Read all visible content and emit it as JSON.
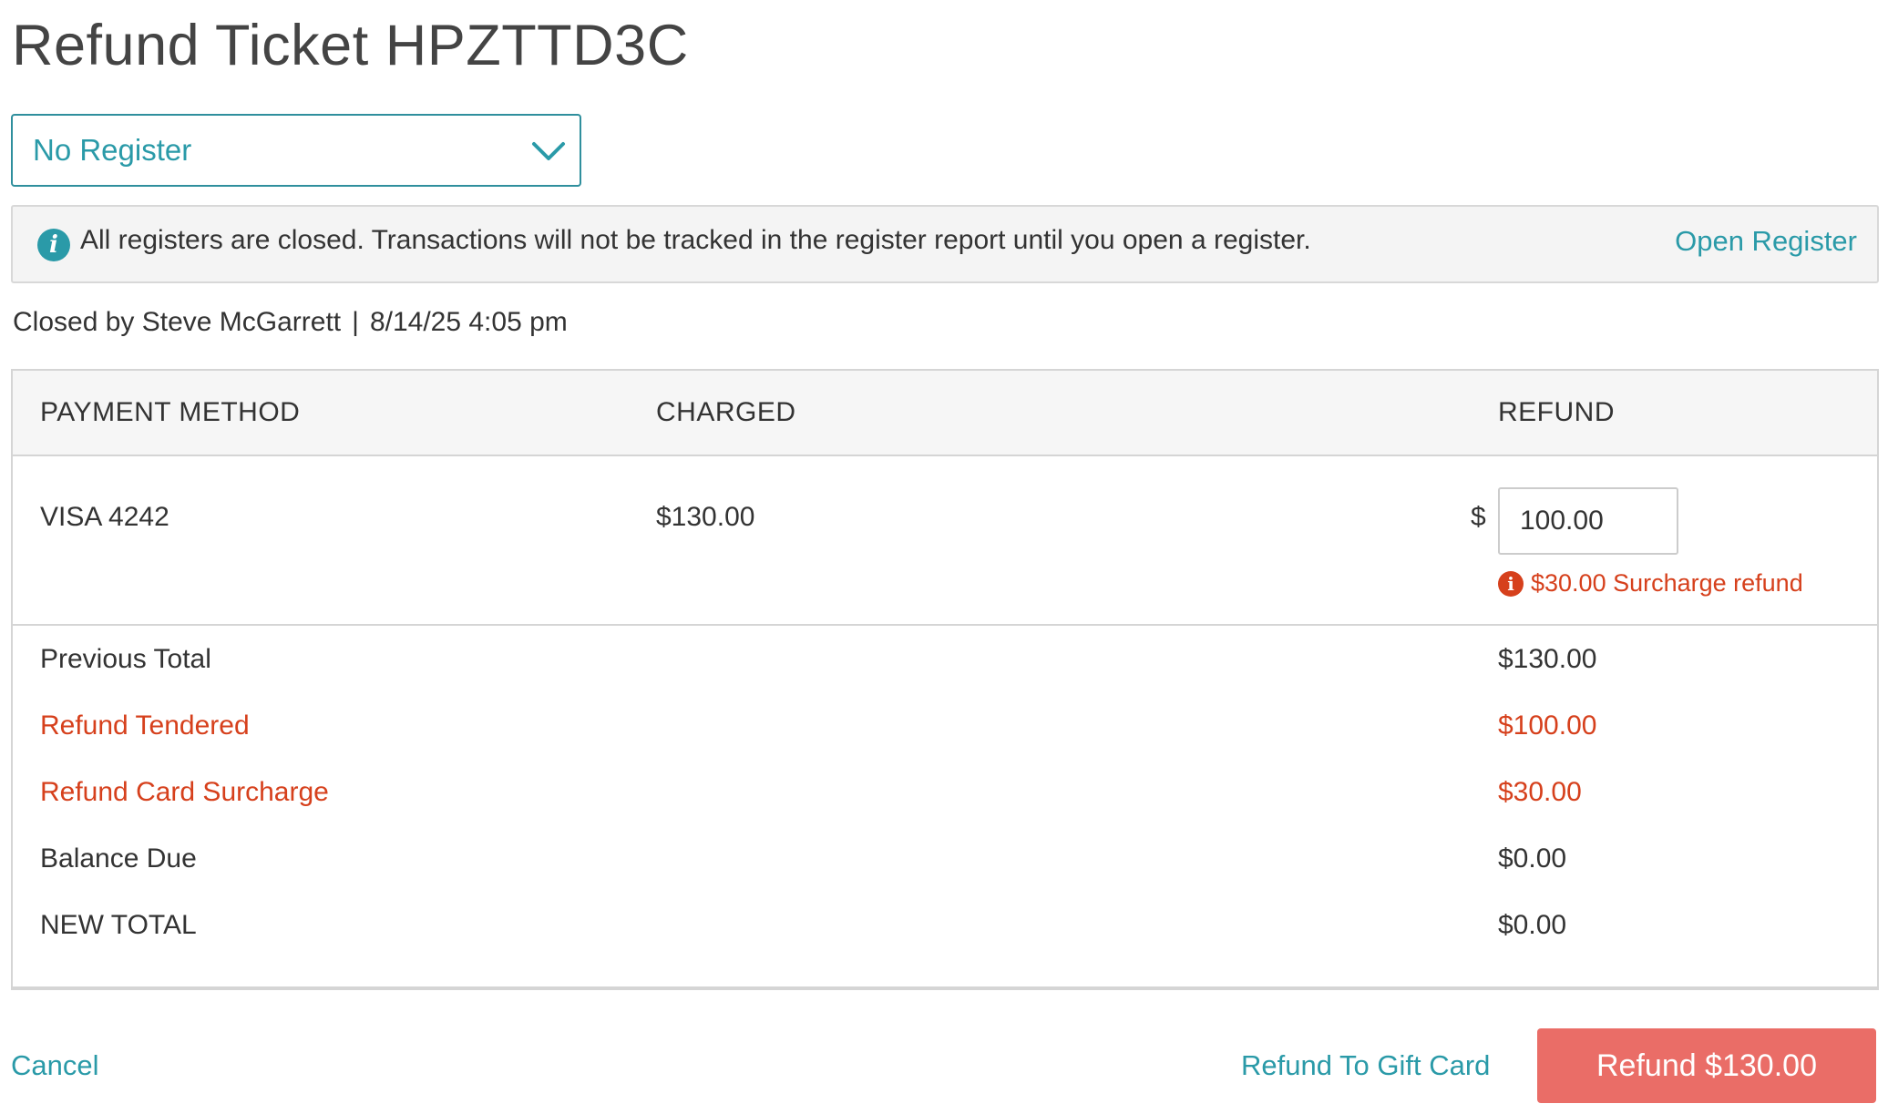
{
  "page": {
    "title": "Refund Ticket HPZTTD3C"
  },
  "register": {
    "selected": "No Register"
  },
  "notice": {
    "message": "All registers are closed. Transactions will not be tracked in the register report until you open a register.",
    "action_label": "Open Register"
  },
  "closed_info": {
    "closed_by": "Closed by Steve McGarrett",
    "separator": "|",
    "datetime": "8/14/25 4:05 pm"
  },
  "table": {
    "headers": {
      "payment_method": "PAYMENT METHOD",
      "charged": "CHARGED",
      "refund": "REFUND"
    },
    "payment_row": {
      "method": "VISA 4242",
      "charged": "$130.00",
      "currency_symbol": "$",
      "refund_value": "100.00",
      "surcharge_note": "$30.00 Surcharge refund"
    },
    "summary": [
      {
        "label": "Previous Total",
        "amount": "$130.00"
      },
      {
        "label": "Refund Tendered",
        "amount": "$100.00"
      },
      {
        "label": "Refund Card Surcharge",
        "amount": "$30.00"
      },
      {
        "label": "Balance Due",
        "amount": "$0.00"
      },
      {
        "label": "NEW TOTAL",
        "amount": "$0.00"
      }
    ]
  },
  "footer": {
    "cancel_label": "Cancel",
    "gift_card_label": "Refund To Gift Card",
    "refund_button_label": "Refund $130.00"
  },
  "colors": {
    "accent": "#2a9aa8",
    "danger": "#d6401c",
    "primary_button": "#ea6d67",
    "text": "#333333"
  },
  "icons": {
    "dropdown": "chevron-down-icon",
    "notice": "info-icon",
    "surcharge": "warning-icon"
  }
}
